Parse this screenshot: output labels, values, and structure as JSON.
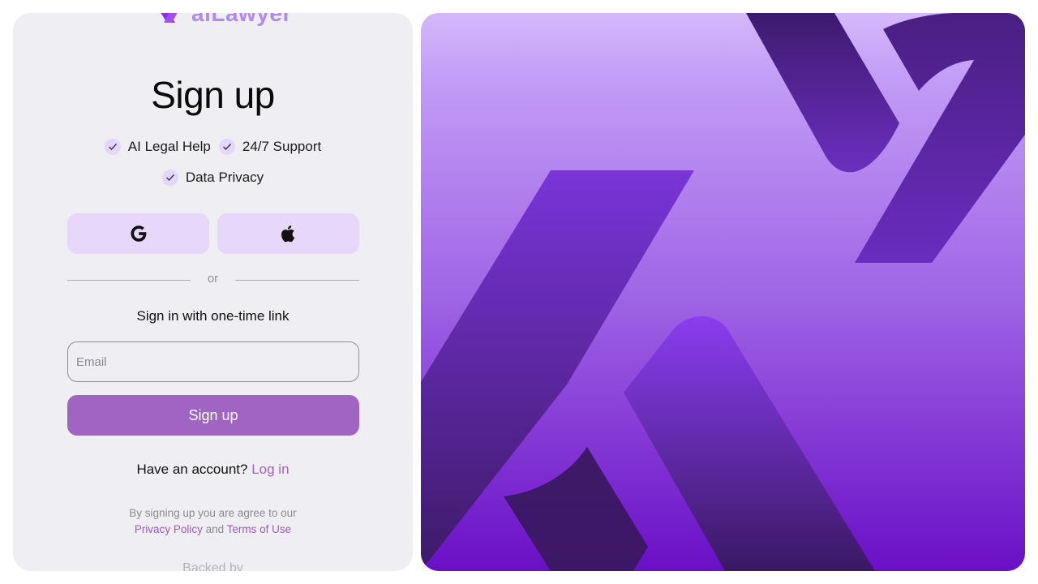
{
  "brand": {
    "name": "aiLawyer"
  },
  "signup": {
    "title": "Sign up",
    "features": [
      "AI Legal Help",
      "24/7 Support",
      "Data Privacy"
    ],
    "social": {
      "google_icon": "google-icon",
      "apple_icon": "apple-icon"
    },
    "divider_text": "or",
    "one_time_link_label": "Sign in with one-time link",
    "email_placeholder": "Email",
    "email_value": "",
    "submit_label": "Sign up",
    "account_prompt": "Have an account?",
    "login_link": "Log in",
    "terms_prefix": "By signing up you are agree to our",
    "privacy_link": "Privacy Policy",
    "terms_and": "and",
    "terms_link": "Terms of Use",
    "backed_by": "Backed by"
  },
  "colors": {
    "accent": "#a064c2",
    "social_bg": "#e6d7fb",
    "panel_bg": "#efeef2",
    "hero_top": "#d3b6fb",
    "hero_bottom": "#6a0fc6"
  }
}
